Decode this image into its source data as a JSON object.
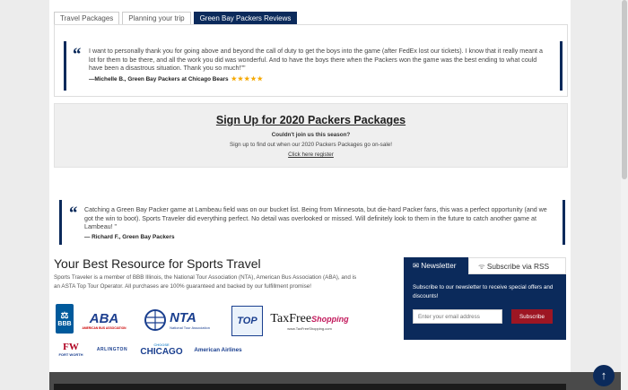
{
  "tabs": [
    {
      "label": "Travel Packages",
      "active": false
    },
    {
      "label": "Planning your trip",
      "active": false
    },
    {
      "label": "Green Bay Packers Reviews",
      "active": true
    }
  ],
  "review1": {
    "text": "I want to personally thank you for going above and beyond the call of duty to get the boys into the game (after FedEx lost our tickets). I know that it really meant a lot for them to be there, and all the work you did was wonderful. And to have the boys there when the Packers won the game was the best ending to what could have been a disastrous situation. Thank you so much!\"\"",
    "author": "—Michelle B., Green Bay Packers at Chicago Bears",
    "stars": "★★★★★"
  },
  "signup": {
    "title": "Sign Up for 2020 Packers Packages",
    "subtitle": "Couldn't join us this season?",
    "desc": "Sign up to find out when our 2020 Packers Packages go on-sale!",
    "link": "Click here register"
  },
  "review2": {
    "text": "Catching a Green Bay Packer game at Lambeau field was on our bucket list. Being from Minnesota, but die-hard Packer fans, this was a perfect opportunity (and we got the win to boot). Sports Traveler did everything perfect. No detail was overlooked or missed. Will definitely look to them in the future to catch another game at Lambeau! \"",
    "author": "— Richard F., Green Bay Packers"
  },
  "resources": {
    "title": "Your Best Resource for Sports Travel",
    "desc": "Sports Traveler is a member of BBB Illinois, the National Tour Association (NTA), American Bus Association (ABA), and is an ASTA Top Tour Operator. All purchases are 100% guaranteed and backed by our fulfillment promise!"
  },
  "logos": {
    "bbb": "BBB",
    "aba": "ABA",
    "aba_sub": "AMERICAN BUS ASSOCIATION",
    "nta": "NTA",
    "nta_sub": "National Tour Association",
    "top": "TOP",
    "taxfree": "TaxFree",
    "taxfree_script": "Shopping",
    "taxfree_url": "www.TaxFreeShopping.com",
    "fw": "FW",
    "fw_sub": "FORT WORTH",
    "arlington": "ARLINGTON",
    "choose": "CHOOSE",
    "chicago": "CHICAGO",
    "aa": "American Airlines"
  },
  "newsletter": {
    "tab_label": "Newsletter",
    "rss_label": "Subscribe via RSS",
    "text": "Subscribe to our newsletter to receive special offers and discounts!",
    "placeholder": "Enter your email address",
    "button": "Subscribe"
  },
  "colors": {
    "navy": "#0b2a5b",
    "red": "#9d1623",
    "gold": "#f5a800"
  }
}
